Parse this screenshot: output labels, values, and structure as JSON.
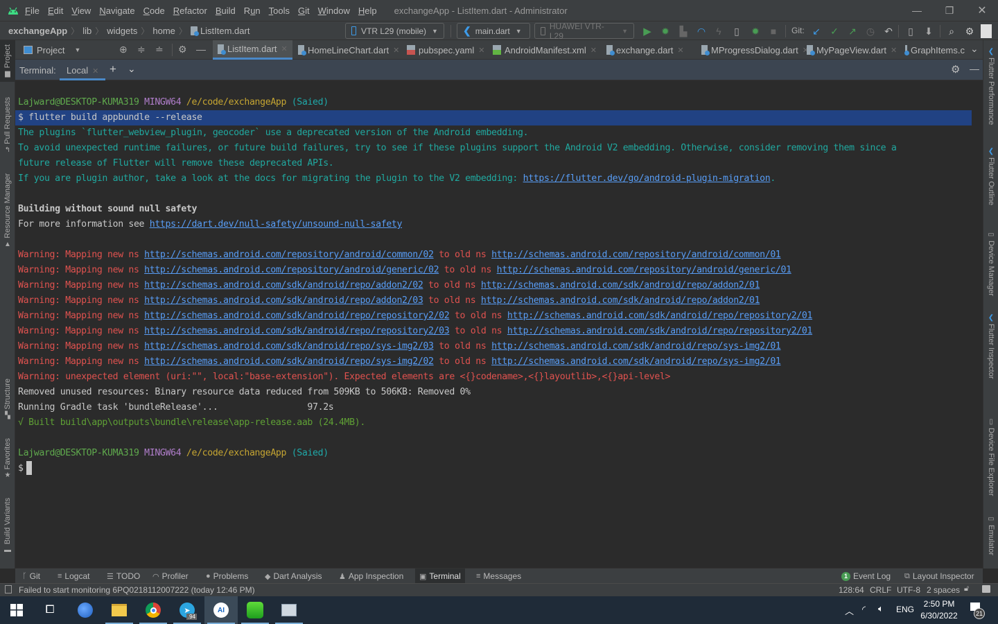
{
  "window": {
    "title": "exchangeApp - ListItem.dart - Administrator",
    "menu": [
      "File",
      "Edit",
      "View",
      "Navigate",
      "Code",
      "Refactor",
      "Build",
      "Run",
      "Tools",
      "Git",
      "Window",
      "Help"
    ],
    "menu_mnemonic_index": [
      0,
      0,
      0,
      0,
      0,
      0,
      0,
      1,
      0,
      0,
      0,
      0
    ]
  },
  "breadcrumb": [
    "exchangeApp",
    "lib",
    "widgets",
    "home",
    "ListItem.dart"
  ],
  "toolbar": {
    "device_selector": "VTR L29 (mobile)",
    "run_config": "main.dart",
    "target_device": "HUAWEI VTR-L29",
    "git_label": "Git:"
  },
  "project_panel": {
    "label": "Project"
  },
  "editor_tabs": [
    {
      "label": "ListItem.dart",
      "type": "dart",
      "active": true
    },
    {
      "label": "HomeLineChart.dart",
      "type": "dart",
      "active": false
    },
    {
      "label": "pubspec.yaml",
      "type": "yaml",
      "active": false
    },
    {
      "label": "AndroidManifest.xml",
      "type": "xml",
      "active": false
    },
    {
      "label": "exchange.dart",
      "type": "dart",
      "active": false
    },
    {
      "label": "MProgressDialog.dart",
      "type": "dart",
      "active": false
    },
    {
      "label": "MyPageView.dart",
      "type": "dart",
      "active": false
    },
    {
      "label": "GraphItems.c",
      "type": "dart",
      "active": false
    }
  ],
  "left_tool_windows": [
    "Project",
    "Pull Requests",
    "Resource Manager",
    "Structure",
    "Favorites",
    "Build Variants"
  ],
  "right_tool_windows": [
    "Flutter Performance",
    "Flutter Outline",
    "Device Manager",
    "Flutter Inspector",
    "Device File Explorer",
    "Emulator"
  ],
  "terminal": {
    "label": "Terminal:",
    "session": "Local",
    "prompt": {
      "user": "Lajward@DESKTOP-KUMA319",
      "shell": "MINGW64",
      "path": "/e/code/exchangeApp",
      "branch": "(Saied)"
    },
    "command": "$ flutter build appbundle --release",
    "deprecation": [
      "The plugins `flutter_webview_plugin, geocoder` use a deprecated version of the Android embedding.",
      "To avoid unexpected runtime failures, or future build failures, try to see if these plugins support the Android V2 embedding. Otherwise, consider removing them since a",
      "future release of Flutter will remove these deprecated APIs."
    ],
    "migration_prefix": "If you are plugin author, take a look at the docs for migrating the plugin to the V2 embedding: ",
    "migration_link": "https://flutter.dev/go/android-plugin-migration",
    "null_safety_heading": "Building without sound null safety",
    "null_safety_prefix": "For more information see ",
    "null_safety_link": "https://dart.dev/null-safety/unsound-null-safety",
    "warn_prefix": "Warning: Mapping new ns ",
    "warn_mid": " to old ns ",
    "warnings": [
      {
        "new": "http://schemas.android.com/repository/android/common/02",
        "old": "http://schemas.android.com/repository/android/common/01"
      },
      {
        "new": "http://schemas.android.com/repository/android/generic/02",
        "old": "http://schemas.android.com/repository/android/generic/01"
      },
      {
        "new": "http://schemas.android.com/sdk/android/repo/addon2/02",
        "old": "http://schemas.android.com/sdk/android/repo/addon2/01"
      },
      {
        "new": "http://schemas.android.com/sdk/android/repo/addon2/03",
        "old": "http://schemas.android.com/sdk/android/repo/addon2/01"
      },
      {
        "new": "http://schemas.android.com/sdk/android/repo/repository2/02",
        "old": "http://schemas.android.com/sdk/android/repo/repository2/01"
      },
      {
        "new": "http://schemas.android.com/sdk/android/repo/repository2/03",
        "old": "http://schemas.android.com/sdk/android/repo/repository2/01"
      },
      {
        "new": "http://schemas.android.com/sdk/android/repo/sys-img2/03",
        "old": "http://schemas.android.com/sdk/android/repo/sys-img2/01"
      },
      {
        "new": "http://schemas.android.com/sdk/android/repo/sys-img2/02",
        "old": "http://schemas.android.com/sdk/android/repo/sys-img2/01"
      }
    ],
    "unexpected_element": "Warning: unexpected element (uri:\"\", local:\"base-extension\"). Expected elements are <{}codename>,<{}layoutlib>,<{}api-level>",
    "removed_resources": "Removed unused resources: Binary resource data reduced from 509KB to 506KB: Removed 0%",
    "gradle_task": "Running Gradle task 'bundleRelease'...                 97.2s",
    "built": "√ Built build\\app\\outputs\\bundle\\release\\app-release.aab (24.4MB).",
    "final_prompt": "$"
  },
  "bottom_tools": [
    {
      "label": "Git",
      "icon": "git-branch-icon"
    },
    {
      "label": "Logcat",
      "icon": "logcat-icon"
    },
    {
      "label": "TODO",
      "icon": "todo-icon"
    },
    {
      "label": "Profiler",
      "icon": "profiler-icon"
    },
    {
      "label": "Problems",
      "icon": "problems-icon"
    },
    {
      "label": "Dart Analysis",
      "icon": "dart-icon"
    },
    {
      "label": "App Inspection",
      "icon": "inspection-icon"
    },
    {
      "label": "Terminal",
      "icon": "terminal-icon",
      "active": true
    },
    {
      "label": "Messages",
      "icon": "messages-icon"
    }
  ],
  "bottom_right_tools": {
    "event_log": "Event Log",
    "event_count": "1",
    "layout_inspector": "Layout Inspector"
  },
  "status": {
    "message": "Failed to start monitoring 6PQ0218112007222 (today 12:46 PM)",
    "position": "128:64",
    "line_sep": "CRLF",
    "encoding": "UTF-8",
    "indent": "2 spaces"
  },
  "taskbar": {
    "time": "2:50 PM",
    "date": "6/30/2022",
    "lang": "ENG",
    "notifications": "21",
    "telegram_badge": ".94"
  },
  "colors": {
    "accent": "#4a88c7",
    "selection": "#214283",
    "link": "#589df6",
    "error": "#e0524f",
    "success": "#5fa035",
    "run_green": "#499c54"
  }
}
